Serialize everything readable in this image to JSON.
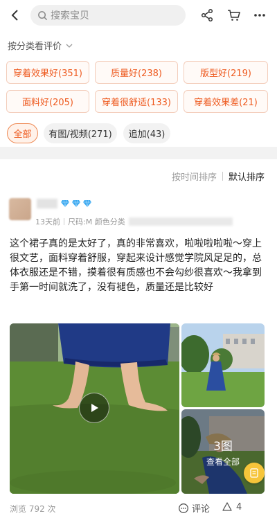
{
  "search": {
    "placeholder": "搜索宝贝"
  },
  "filter": {
    "title": "按分类看评价",
    "tags": [
      "穿着效果好(351)",
      "质量好(238)",
      "版型好(219)",
      "面料好(205)",
      "穿着很舒适(133)",
      "穿着效果差(21)"
    ],
    "tabs": [
      "全部",
      "有图/视频(271)",
      "追加(43)"
    ],
    "active_tab": "全部"
  },
  "sort": {
    "by_time": "按时间排序",
    "default": "默认排序"
  },
  "review": {
    "date": "13天前",
    "spec": "尺码:M 颜色分类",
    "content": "这个裙子真的是太好了，真的非常喜欢，啦啦啦啦啦～穿上很文艺，面料穿着舒服，穿起来设计感觉学院风足足的，总体衣服还是不错，摸着很有质感也不会勾纱很喜欢～我拿到手第一时间就洗了，没有褪色，质量还是比较好",
    "more_photos_count": "3图",
    "more_photos_label": "查看全部",
    "views": "浏览 792 次",
    "comment_label": "评论",
    "likes": "4"
  },
  "colors": {
    "accent": "#ee5a1f",
    "tag_border": "#f3cdbb",
    "diamond": "#3aa8f0"
  }
}
